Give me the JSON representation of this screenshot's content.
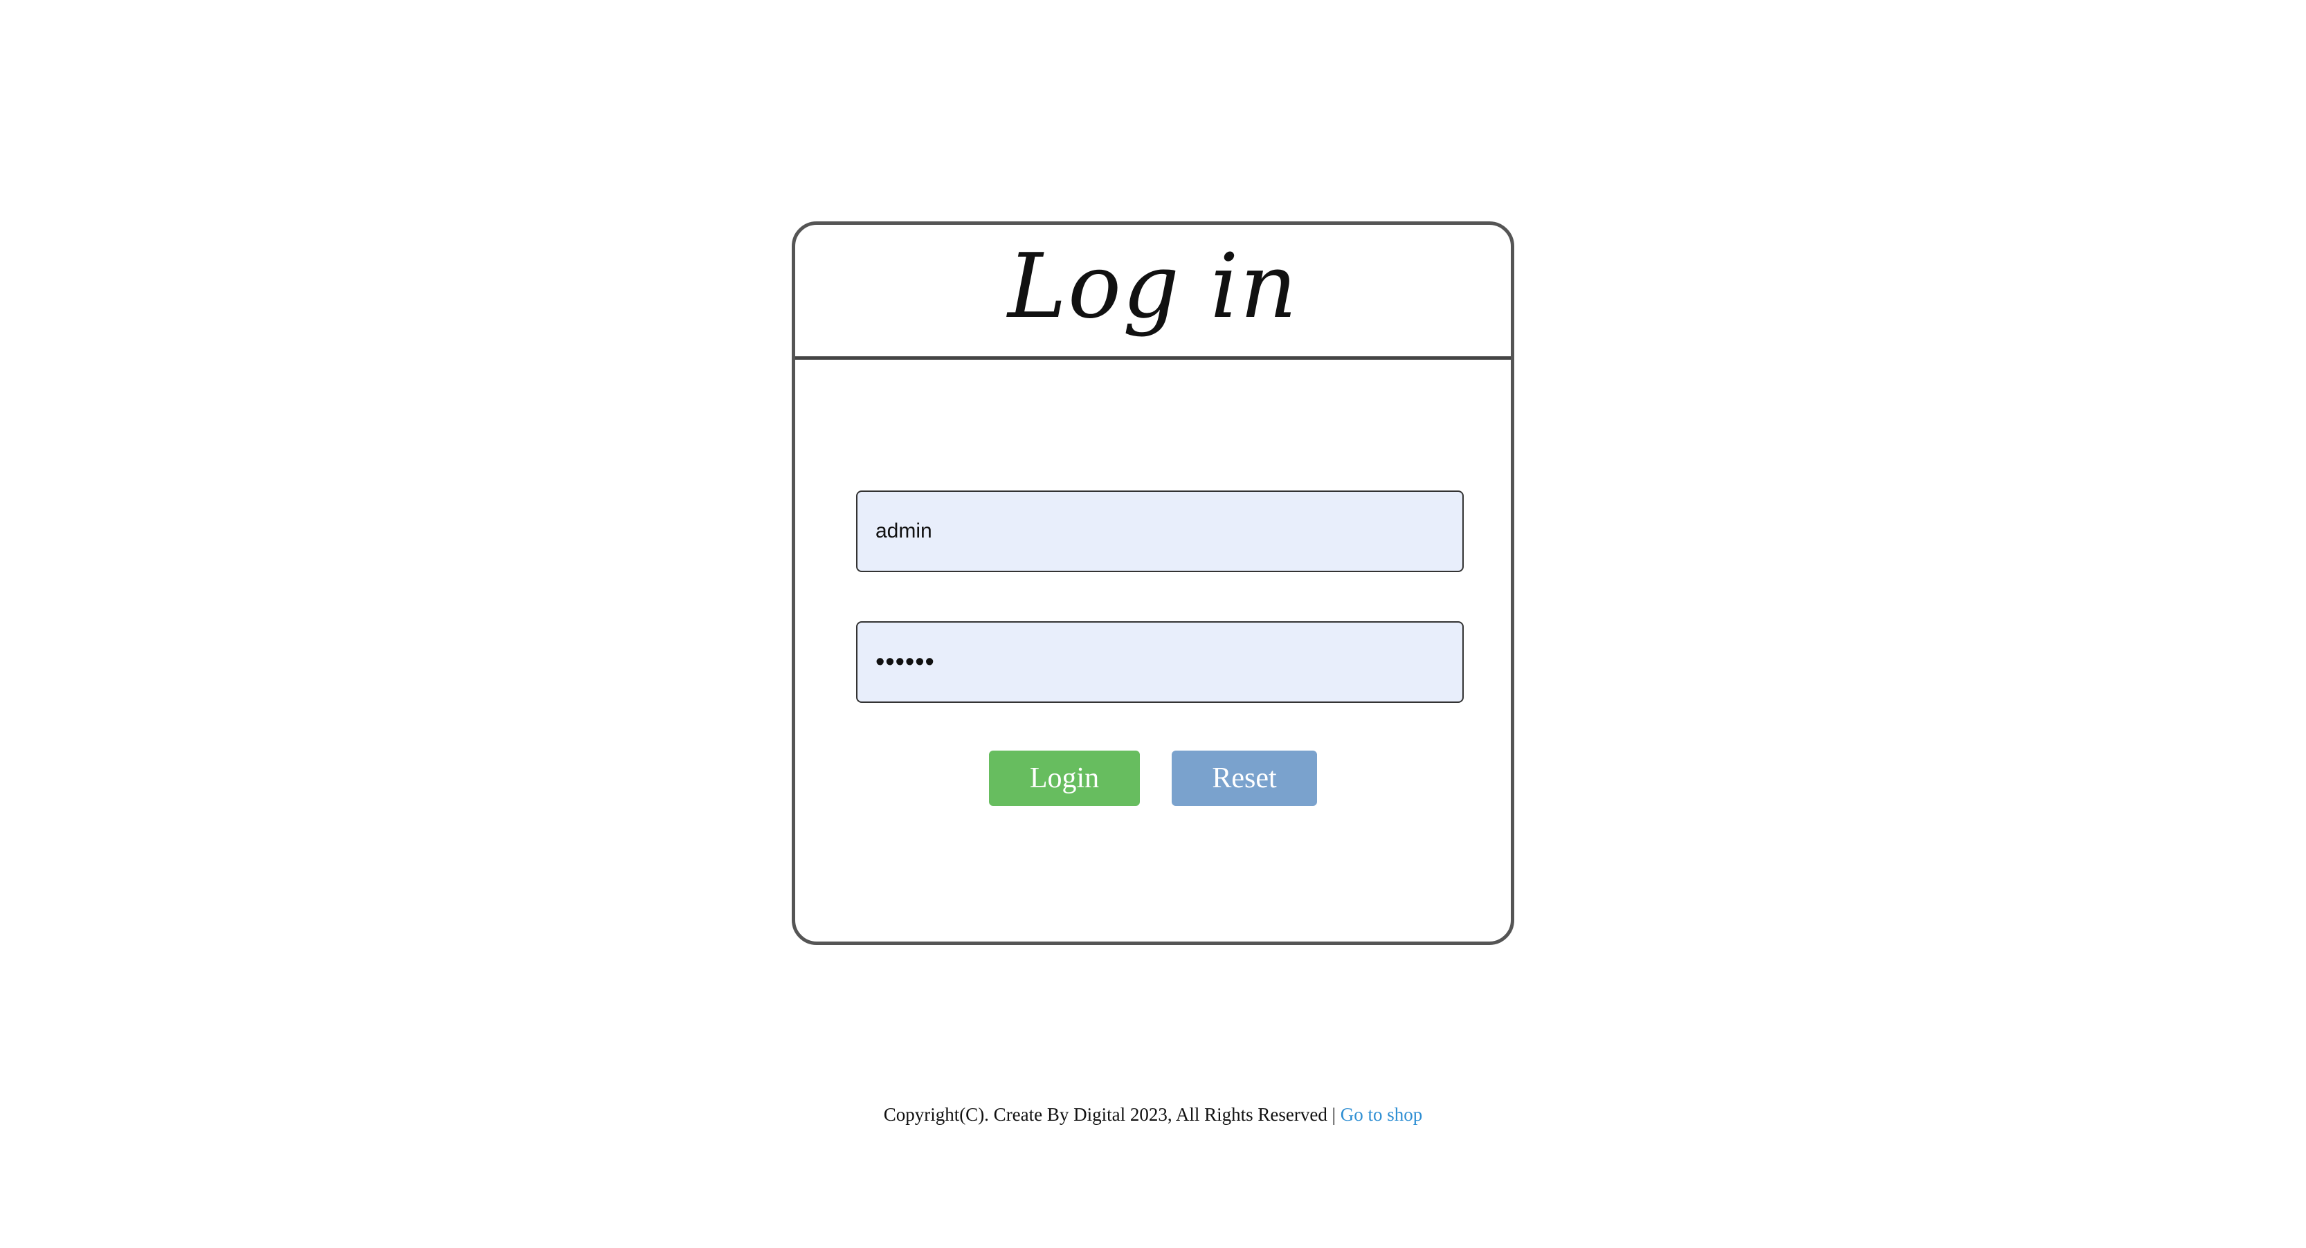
{
  "login_card": {
    "title": "Log in",
    "username": {
      "value": "admin"
    },
    "password": {
      "value": "••••••"
    },
    "login_button_label": "Login",
    "reset_button_label": "Reset"
  },
  "footer": {
    "copyright_text": "Copyright(C). Create By Digital 2023, All Rights Reserved |",
    "link_text": "Go to shop"
  },
  "colors": {
    "login_button": "#67bd5f",
    "reset_button": "#7aa2cd",
    "input_background": "#e8eefb",
    "link": "#2f8fd3"
  }
}
